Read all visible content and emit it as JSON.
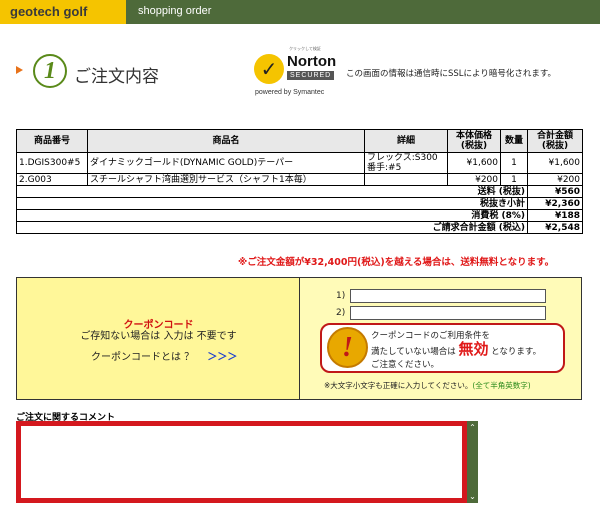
{
  "header": {
    "logo": "geotech golf",
    "section": "shopping order"
  },
  "heading": {
    "step": "1",
    "title": "ご注文内容"
  },
  "norton": {
    "small_text": "クリックして検証",
    "brand": "Norton",
    "secured": "SECURED",
    "powered": "powered by Symantec"
  },
  "ssl_note": "この画面の情報は通信時にSSLにより暗号化されます。",
  "order_table": {
    "headers": [
      "商品番号",
      "商品名",
      "詳細",
      "本体価格\n(税抜)",
      "数量",
      "合計金額\n(税抜)"
    ],
    "rows": [
      {
        "no": "1.",
        "code": "DGIS300#5",
        "name": "ダイナミックゴールド(DYNAMIC GOLD)テーパー",
        "detail_1": "フレックス:S300",
        "detail_2": "番手:#5",
        "price": "¥1,600",
        "qty": "1",
        "total": "¥1,600"
      },
      {
        "no": "2.",
        "code": "G003",
        "name": "スチールシャフト湾曲選別サービス（シャフト1本毎）",
        "detail_1": "",
        "detail_2": "",
        "price": "¥200",
        "qty": "1",
        "total": "¥200"
      }
    ],
    "summary": [
      {
        "label": "送料 (税抜)",
        "value": "¥560"
      },
      {
        "label": "税抜き小計",
        "value": "¥2,360"
      },
      {
        "label": "消費税 (8%)",
        "value": "¥188"
      },
      {
        "label": "ご請求合計金額 (税込)",
        "value": "¥2,548"
      }
    ]
  },
  "free_shipping_note": "※ご注文金額が¥32,400円(税込)を越える場合は、送料無料となります。",
  "coupon": {
    "title": "クーポンコード",
    "subtitle": "ご存知ない場合は 入力は 不要です",
    "what_label": "クーポンコードとは ？",
    "what_link": "＞＞＞",
    "field1_label": "1)",
    "field2_label": "2)",
    "field1_value": "",
    "field2_value": "",
    "warning_line1": "クーポンコードのご利用条件を",
    "warning_line2a": "満たしていない場合は",
    "warning_big": "無効",
    "warning_line2b": "となります。",
    "warning_line3": "ご注意ください。",
    "hint_a": "※大文字小文字も正確に入力してください。",
    "hint_b": "(全て半角英数字)"
  },
  "comment": {
    "label": "ご注文に関するコメント",
    "value": ""
  },
  "colors": {
    "header_bg": "#4e6a3a",
    "logo_bg": "#f5c400",
    "accent_red": "#d4181e",
    "coupon_bg": "#fff799"
  },
  "icons": {
    "step": "step-1-circle-icon",
    "arrow": "orange-triangle-icon",
    "warning": "exclamation-icon",
    "norton": "norton-check-icon"
  }
}
